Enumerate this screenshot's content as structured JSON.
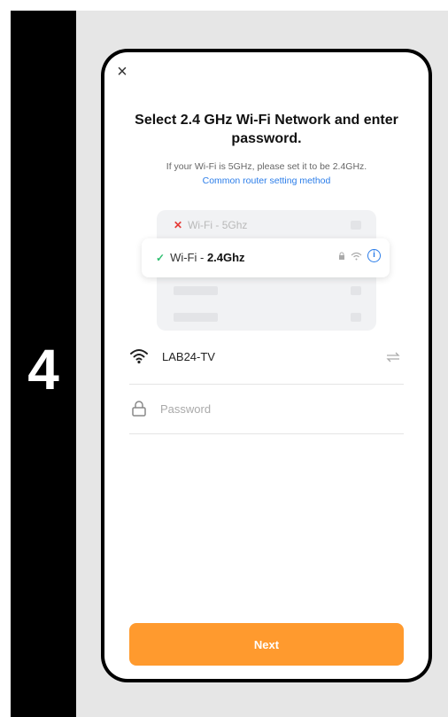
{
  "step": {
    "number": "4"
  },
  "dialog": {
    "close_glyph": "×",
    "title": "Select 2.4 GHz Wi-Fi Network and enter password.",
    "hint": "If your Wi-Fi is 5GHz, please set it to be 2.4GHz.",
    "link": "Common router setting method"
  },
  "illustration": {
    "bad_network": {
      "label": "Wi-Fi - 5Ghz",
      "icon": "x-icon"
    },
    "good_network": {
      "prefix": "Wi-Fi - ",
      "bold": "2.4Ghz",
      "icon": "check-icon"
    },
    "info_glyph": "i"
  },
  "form": {
    "ssid": "LAB24-TV",
    "password_placeholder": "Password",
    "next_label": "Next"
  },
  "colors": {
    "accent": "#ff9a2e",
    "link": "#2b7de9",
    "error": "#e53935",
    "success": "#2fbf71"
  }
}
